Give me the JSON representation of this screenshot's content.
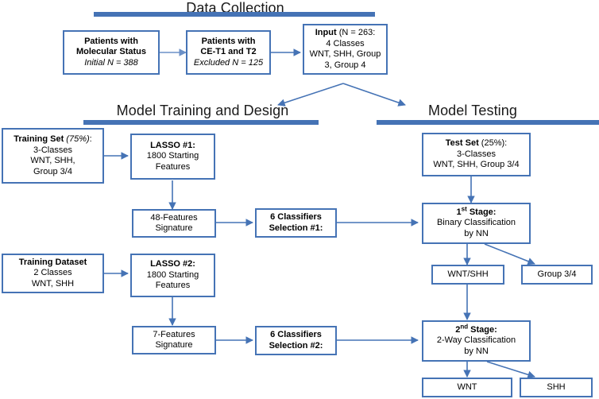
{
  "figure": {
    "kind": "flowchart",
    "colors": {
      "accent": "#4573B5",
      "box_border": "#4573B5",
      "box_fill": "#FFFFFF",
      "text": "#000000",
      "arrow": "#4573B5"
    }
  },
  "sections": [
    {
      "id": "data-collection",
      "title": "Data Collection"
    },
    {
      "id": "model-training",
      "title": "Model Training and Design"
    },
    {
      "id": "model-testing",
      "title": "Model Testing"
    }
  ],
  "nodes": {
    "patients_molecular": {
      "lines": [
        {
          "text": "Patients with",
          "style": "bold"
        },
        {
          "text": "Molecular Status",
          "style": "bold"
        },
        {
          "text": "Initial N = 388",
          "style": "italic"
        }
      ]
    },
    "patients_cet1": {
      "lines": [
        {
          "text": "Patients with",
          "style": "bold"
        },
        {
          "text": "CE-T1 and T2",
          "style": "bold"
        },
        {
          "text": "Excluded N = 125",
          "style": "italic"
        }
      ]
    },
    "input": {
      "lines": [
        {
          "text": "Input",
          "style": "bold",
          "suffix": " (N = 263:"
        },
        {
          "text": "4 Classes",
          "style": "normal"
        },
        {
          "text": "WNT, SHH, Group",
          "style": "normal"
        },
        {
          "text": "3, Group 4",
          "style": "normal"
        }
      ]
    },
    "training_set": {
      "lines": [
        {
          "text": "Training Set",
          "style": "bold",
          "suffix_italic": " (75%)",
          "suffix": ":"
        },
        {
          "text": "3-Classes",
          "style": "normal"
        },
        {
          "text": "WNT, SHH,",
          "style": "normal"
        },
        {
          "text": "Group 3/4",
          "style": "normal"
        }
      ]
    },
    "lasso1": {
      "lines": [
        {
          "text": "LASSO #1:",
          "style": "bold"
        },
        {
          "text": "1800 Starting",
          "style": "normal"
        },
        {
          "text": "Features",
          "style": "normal"
        }
      ]
    },
    "features48": {
      "lines": [
        {
          "text": "48-Features",
          "style": "normal"
        },
        {
          "text": "Signature",
          "style": "normal"
        }
      ]
    },
    "classifiers1": {
      "lines": [
        {
          "text": "6 Classifiers",
          "style": "bold"
        },
        {
          "text": "Selection #1:",
          "style": "bold"
        }
      ]
    },
    "training_dataset": {
      "lines": [
        {
          "text": "Training Dataset",
          "style": "bold"
        },
        {
          "text": "2 Classes",
          "style": "normal"
        },
        {
          "text": "WNT, SHH",
          "style": "normal"
        }
      ]
    },
    "lasso2": {
      "lines": [
        {
          "text": "LASSO #2:",
          "style": "bold"
        },
        {
          "text": "1800 Starting",
          "style": "normal"
        },
        {
          "text": "Features",
          "style": "normal"
        }
      ]
    },
    "features7": {
      "lines": [
        {
          "text": "7-Features",
          "style": "normal"
        },
        {
          "text": "Signature",
          "style": "normal"
        }
      ]
    },
    "classifiers2": {
      "lines": [
        {
          "text": "6 Classifiers",
          "style": "bold"
        },
        {
          "text": "Selection #2:",
          "style": "bold"
        }
      ]
    },
    "test_set": {
      "lines": [
        {
          "text": "Test Set",
          "style": "bold",
          "suffix": " (25%):"
        },
        {
          "text": "3-Classes",
          "style": "normal"
        },
        {
          "text": "WNT, SHH, Group 3/4",
          "style": "normal"
        }
      ]
    },
    "stage1": {
      "lines": [
        {
          "text": "1st Stage:",
          "style": "bold",
          "sup": "st"
        },
        {
          "text": "Binary Classification",
          "style": "normal"
        },
        {
          "text": "by NN",
          "style": "normal"
        }
      ]
    },
    "wnt_shh": {
      "lines": [
        {
          "text": "WNT/SHH",
          "style": "normal"
        }
      ]
    },
    "group34": {
      "lines": [
        {
          "text": "Group 3/4",
          "style": "normal"
        }
      ]
    },
    "stage2": {
      "lines": [
        {
          "text": "2nd Stage:",
          "style": "bold",
          "sup": "nd"
        },
        {
          "text": "2-Way Classification",
          "style": "normal"
        },
        {
          "text": "by NN",
          "style": "normal"
        }
      ]
    },
    "wnt": {
      "lines": [
        {
          "text": "WNT",
          "style": "normal"
        }
      ]
    },
    "shh": {
      "lines": [
        {
          "text": "SHH",
          "style": "normal"
        }
      ]
    }
  }
}
